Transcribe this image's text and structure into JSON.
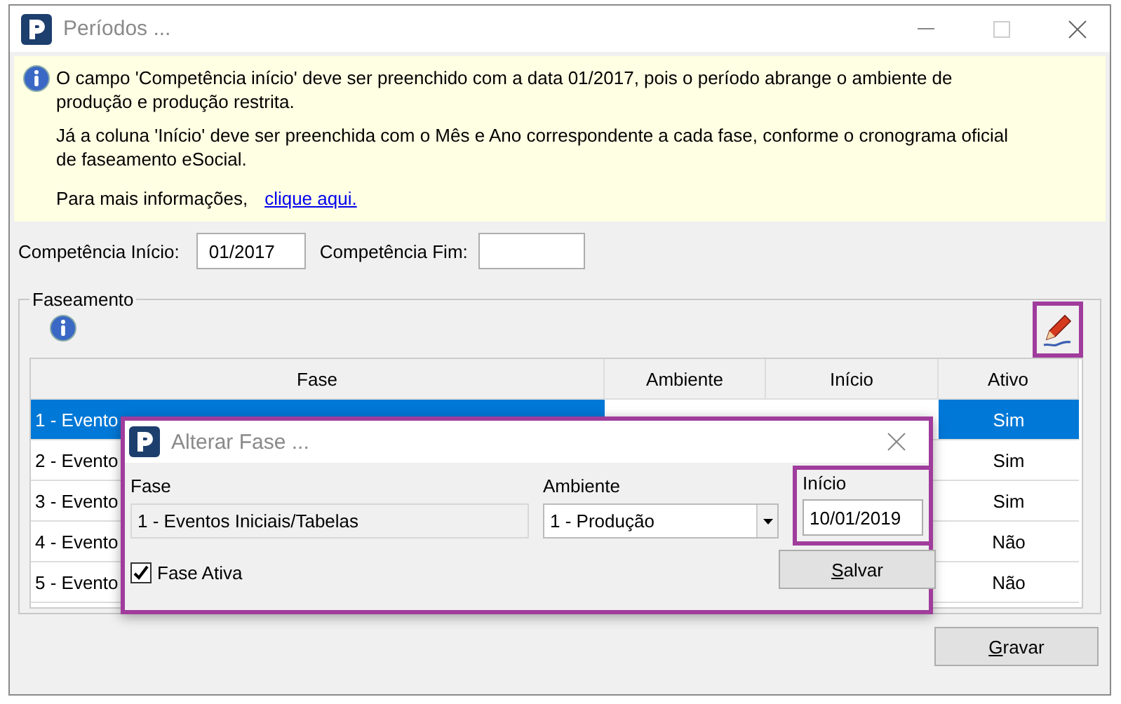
{
  "window": {
    "title": "Períodos ..."
  },
  "notice": {
    "paragraphs": [
      "O campo 'Competência início' deve ser preenchido com a data 01/2017, pois o período abrange o ambiente de produção e produção restrita.",
      "Já a coluna 'Início' deve ser preenchida com o Mês e Ano correspondente a cada fase, conforme o cronograma oficial de faseamento eSocial."
    ],
    "more_label": "Para mais informações,",
    "link": "clique aqui."
  },
  "competencia": {
    "inicio_label": "Competência Início:",
    "inicio_value": "01/2017",
    "fim_label": "Competência Fim:"
  },
  "faseamento": {
    "title": "Faseamento",
    "edit_highlighted": true,
    "table": {
      "columns": [
        "Fase",
        "Ambiente",
        "Início",
        "Ativo"
      ],
      "rows": [
        {
          "fase": "1 - Evento",
          "ativo": "Sim",
          "selected": true
        },
        {
          "fase": "2 - Evento",
          "ativo": "Sim",
          "selected": false
        },
        {
          "fase": "3 - Evento",
          "ativo": "Sim",
          "selected": false
        },
        {
          "fase": "4 - Evento",
          "ativo": "Não",
          "selected": false
        },
        {
          "fase": "5 - Evento",
          "ativo": "Não",
          "selected": false
        }
      ]
    }
  },
  "dialog": {
    "title": "Alterar Fase ...",
    "highlighted": true,
    "fase_label": "Fase",
    "fase_value": "1 - Eventos Iniciais/Tabelas",
    "ambiente_label": "Ambiente",
    "ambiente_value": "1 - Produção",
    "inicio_label": "Início",
    "inicio_value": "10/01/2019",
    "inicio_highlighted": true,
    "ativa_label": "Fase Ativa",
    "ativa_checked": true,
    "save_button": {
      "label": "Salvar"
    }
  },
  "gravar_button": {
    "label": "Gravar"
  }
}
